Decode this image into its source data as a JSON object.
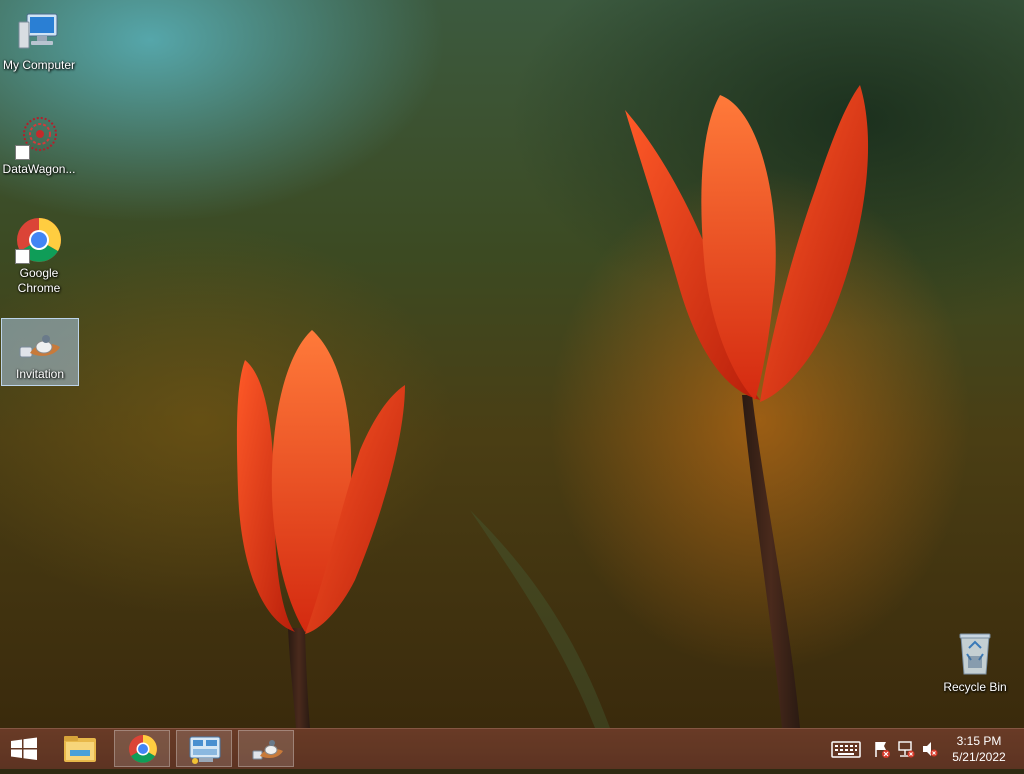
{
  "desktop": {
    "icons": [
      {
        "label": "My Computer"
      },
      {
        "label": "DataWagon..."
      },
      {
        "label": "Google Chrome"
      },
      {
        "label": "Invitation"
      },
      {
        "label": "Recycle Bin"
      }
    ]
  },
  "taskbar": {
    "pinned": [
      {
        "name": "File Explorer",
        "icon": "folder-icon"
      },
      {
        "name": "Google Chrome",
        "icon": "chrome-icon"
      },
      {
        "name": "Control Panel",
        "icon": "control-panel-icon"
      },
      {
        "name": "Invitation",
        "icon": "invitation-icon"
      }
    ],
    "clock": {
      "time": "3:15 PM",
      "date": "5/21/2022"
    }
  },
  "colors": {
    "taskbar": "#6a3a28",
    "accent_selection": "#aac8e6"
  }
}
